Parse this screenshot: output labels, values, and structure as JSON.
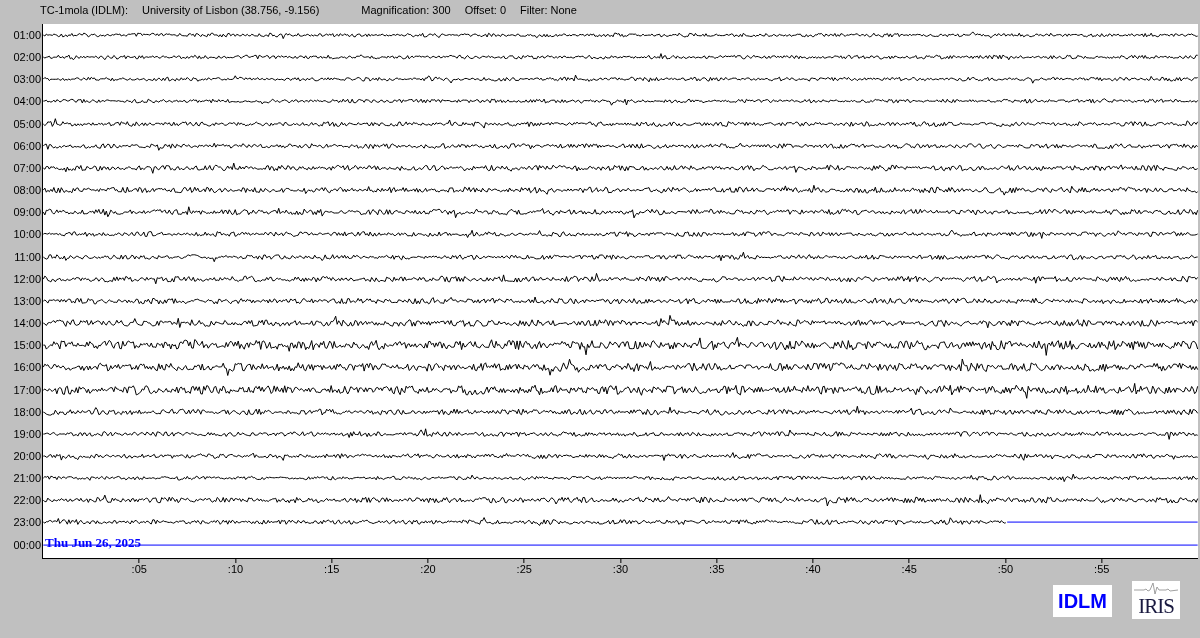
{
  "header": {
    "station": "TC-1mola (IDLM):",
    "location": "University of Lisbon (38.756, -9.156)",
    "magnification": "Magnification: 300",
    "offset": "Offset: 0",
    "filter": "Filter: None"
  },
  "rows": [
    {
      "label": "01:00",
      "kind": "full"
    },
    {
      "label": "02:00",
      "kind": "full"
    },
    {
      "label": "03:00",
      "kind": "full"
    },
    {
      "label": "04:00",
      "kind": "full"
    },
    {
      "label": "05:00",
      "kind": "full"
    },
    {
      "label": "06:00",
      "kind": "full"
    },
    {
      "label": "07:00",
      "kind": "full"
    },
    {
      "label": "08:00",
      "kind": "full"
    },
    {
      "label": "09:00",
      "kind": "full"
    },
    {
      "label": "10:00",
      "kind": "full"
    },
    {
      "label": "11:00",
      "kind": "full"
    },
    {
      "label": "12:00",
      "kind": "full"
    },
    {
      "label": "13:00",
      "kind": "full"
    },
    {
      "label": "14:00",
      "kind": "full"
    },
    {
      "label": "15:00",
      "kind": "full"
    },
    {
      "label": "16:00",
      "kind": "full"
    },
    {
      "label": "17:00",
      "kind": "full"
    },
    {
      "label": "18:00",
      "kind": "full"
    },
    {
      "label": "19:00",
      "kind": "full"
    },
    {
      "label": "20:00",
      "kind": "full"
    },
    {
      "label": "21:00",
      "kind": "full"
    },
    {
      "label": "22:00",
      "kind": "full"
    },
    {
      "label": "23:00",
      "kind": "partial",
      "level": 0.835
    },
    {
      "label": "00:00",
      "kind": "empty",
      "date": "Thu Jun 26, 2025"
    }
  ],
  "x_axis": [
    ":05",
    ":10",
    ":15",
    ":20",
    ":25",
    ":30",
    ":35",
    ":40",
    ":45",
    ":50",
    ":55"
  ],
  "logos": {
    "network": "IDLM",
    "iris": "IRIS"
  }
}
